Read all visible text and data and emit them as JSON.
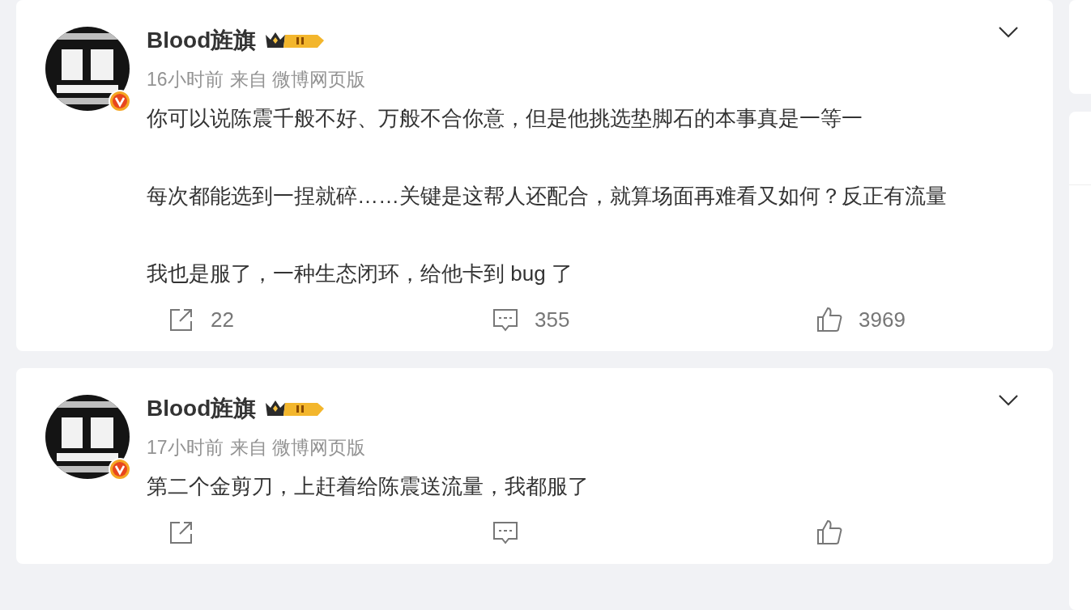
{
  "posts": [
    {
      "author": "Blood旌旗",
      "time": "16小时前",
      "source": "来自 微博网页版",
      "paragraphs": [
        "你可以说陈震千般不好、万般不合你意，但是他挑选垫脚石的本事真是一等一",
        "每次都能选到一捏就碎……关键是这帮人还配合，就算场面再难看又如何？反正有流量",
        "我也是服了，一种生态闭环，给他卡到 bug 了"
      ],
      "actions": [
        {
          "kind": "share",
          "count": "22"
        },
        {
          "kind": "comment",
          "count": "355"
        },
        {
          "kind": "like",
          "count": "3969"
        }
      ]
    },
    {
      "author": "Blood旌旗",
      "time": "17小时前",
      "source": "来自 微博网页版",
      "paragraphs": [
        "第二个金剪刀，上赶着给陈震送流量，我都服了"
      ],
      "actions": [
        {
          "kind": "share"
        },
        {
          "kind": "comment"
        },
        {
          "kind": "like"
        }
      ]
    }
  ]
}
